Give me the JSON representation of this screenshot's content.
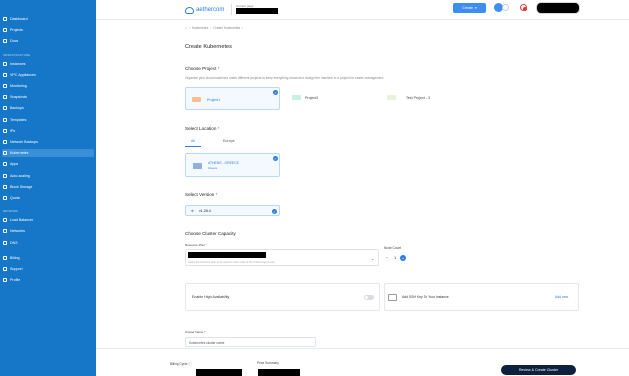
{
  "sidebar": {
    "groups": [
      {
        "header": "",
        "items": [
          {
            "label": "Dashboard",
            "icon": "grid-icon",
            "active": false
          },
          {
            "label": "Projects",
            "icon": "folder-icon",
            "active": false
          },
          {
            "label": "Docs",
            "icon": "doc-icon",
            "active": false
          }
        ]
      },
      {
        "header": "INFRASTRUCTURE",
        "items": [
          {
            "label": "Instances",
            "icon": "server-icon",
            "active": false
          },
          {
            "label": "VPC Appliances",
            "icon": "network-icon",
            "active": false
          },
          {
            "label": "Monitoring",
            "icon": "chart-icon",
            "active": false
          },
          {
            "label": "Snapshots",
            "icon": "camera-icon",
            "active": false
          },
          {
            "label": "Backups",
            "icon": "archive-icon",
            "active": false
          },
          {
            "label": "Templates",
            "icon": "template-icon",
            "active": false
          },
          {
            "label": "IPs",
            "icon": "ip-icon",
            "active": false
          },
          {
            "label": "Network Backups",
            "icon": "cloud-icon",
            "active": false
          },
          {
            "label": "Kubernetes",
            "icon": "kubernetes-icon",
            "active": true
          },
          {
            "label": "Apps",
            "icon": "apps-icon",
            "active": false
          },
          {
            "label": "Auto-scaling",
            "icon": "scale-icon",
            "active": false
          },
          {
            "label": "Block Storage",
            "icon": "storage-icon",
            "active": false
          },
          {
            "label": "Quota",
            "icon": "quota-icon",
            "active": false
          }
        ]
      },
      {
        "header": "NETWORK",
        "items": [
          {
            "label": "Load Balancer",
            "icon": "balancer-icon",
            "active": false
          },
          {
            "label": "Networks",
            "icon": "network-icon",
            "active": false
          },
          {
            "label": "DNS",
            "icon": "globe-icon",
            "active": false
          }
        ]
      },
      {
        "header": "",
        "items": [
          {
            "label": "Billing",
            "icon": "billing-icon",
            "active": false
          },
          {
            "label": "Support",
            "icon": "support-icon",
            "active": false
          },
          {
            "label": "Profile",
            "icon": "user-icon",
            "active": false
          }
        ]
      }
    ]
  },
  "header": {
    "logo_text": "aethercom",
    "current_page_label": "Current page",
    "create_label": "Create"
  },
  "breadcrumb": {
    "items": [
      "Kubernetes",
      "Create Kubernetes"
    ]
  },
  "page_title": "Create Kubernetes",
  "project": {
    "title": "Choose Project",
    "subtitle": "Organize your cloud machines under different projects to keep everything structured. Assign the machine to a project for easier management.",
    "options": [
      {
        "label": "Project1",
        "selected": true
      },
      {
        "label": "Project3",
        "selected": false
      },
      {
        "label": "Test Project - 3",
        "selected": false
      }
    ]
  },
  "location": {
    "title": "Select Location",
    "tabs": [
      "All",
      "Europe"
    ],
    "active_tab": "All",
    "cards": [
      {
        "name": "ATHENS - GREECE",
        "country": "Greece",
        "selected": true
      }
    ]
  },
  "version": {
    "title": "Select Version",
    "value": "v1.28.4"
  },
  "capacity": {
    "title": "Choose Cluster Capacity",
    "resource_plan_label": "Resource Plan",
    "resource_plan_helper": "Select the resource plan to be used for each node of the Kubernetes cluster",
    "node_count_label": "Node Count",
    "node_count_value": "1"
  },
  "ha": {
    "label": "Enable High Availability"
  },
  "ssh": {
    "label": "Add SSH Key To Your Instance",
    "action": "Add new"
  },
  "cluster_name": {
    "label": "Cluster Name",
    "placeholder": "Kubernetes cluster name"
  },
  "footer": {
    "billing_cycle_label": "Billing Cycle",
    "price_summary_label": "Price Summary",
    "submit_label": "Review & Create Cluster"
  },
  "colors": {
    "sidebar": "#1677c8",
    "accent": "#2b7de0",
    "cta": "#0d2040"
  }
}
